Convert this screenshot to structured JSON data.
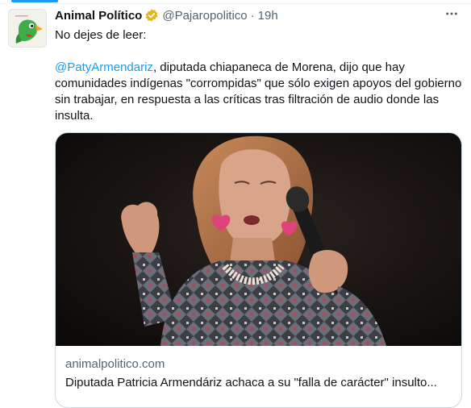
{
  "tweet": {
    "author_name": "Animal Político",
    "handle": "@Pajaropolitico",
    "separator": "·",
    "time": "19h",
    "text_intro": "No dejes de leer:",
    "mention": "@PatyArmendariz",
    "text_body": ", diputada chiapaneca de Morena, dijo que hay comunidades indígenas \"corrompidas\" que sólo exigen apoyos del gobierno sin trabajar, en respuesta a las críticas tras filtración de audio donde las insulta."
  },
  "card": {
    "domain": "animalpolitico.com",
    "title": "Diputada Patricia Armendáriz achaca a su \"falla de carácter\" insulto..."
  },
  "icons": {
    "verified": "verified-badge-icon",
    "more": "more-options-icon",
    "avatar": "parrot-logo"
  },
  "colors": {
    "accent": "#1d9bf0",
    "verified_gold": "#e2b719",
    "secondary_text": "#536471"
  }
}
